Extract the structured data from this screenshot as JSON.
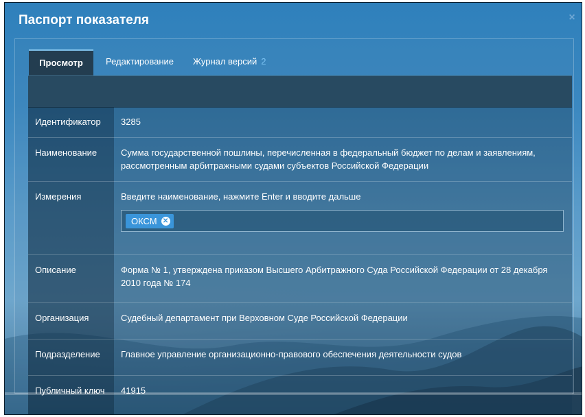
{
  "dialog": {
    "title": "Паспорт показателя",
    "close_glyph": "×"
  },
  "tabs": [
    {
      "label": "Просмотр",
      "active": true
    },
    {
      "label": "Редактирование"
    },
    {
      "label": "Журнал версий",
      "count": "2"
    }
  ],
  "fields": {
    "identifier": {
      "label": "Идентификатор",
      "value": "3285"
    },
    "name": {
      "label": "Наименование",
      "value": "Сумма государственной пошлины, перечисленная в федеральный бюджет по делам и заявлениям, рассмотренным арбитражными судами субъектов Российской Федерации"
    },
    "dimensions": {
      "label": "Измерения",
      "hint": "Введите наименование, нажмите Enter и вводите дальше",
      "tags": [
        "ОКСМ"
      ]
    },
    "description": {
      "label": "Описание",
      "value": "Форма № 1, утверждена приказом Высшего Арбитражного Суда Российской Федерации от 28 декабря 2010 года № 174"
    },
    "organization": {
      "label": "Организация",
      "value": "Судебный департамент при Верховном Суде Российской Федерации"
    },
    "division": {
      "label": "Подразделение",
      "value": "Главное управление организационно-правового обеспечения деятельности судов"
    },
    "public_key": {
      "label": "Публичный ключ",
      "value": "41915"
    }
  },
  "icons": {
    "close": "close-icon",
    "chip_remove": "remove-circle-icon"
  },
  "colors": {
    "title_bar": "#2f80bb",
    "active_tab": "#233d50",
    "tab_accent": "#7fc1ea",
    "chip": "#3a95da",
    "count": "#7cc3f2"
  }
}
